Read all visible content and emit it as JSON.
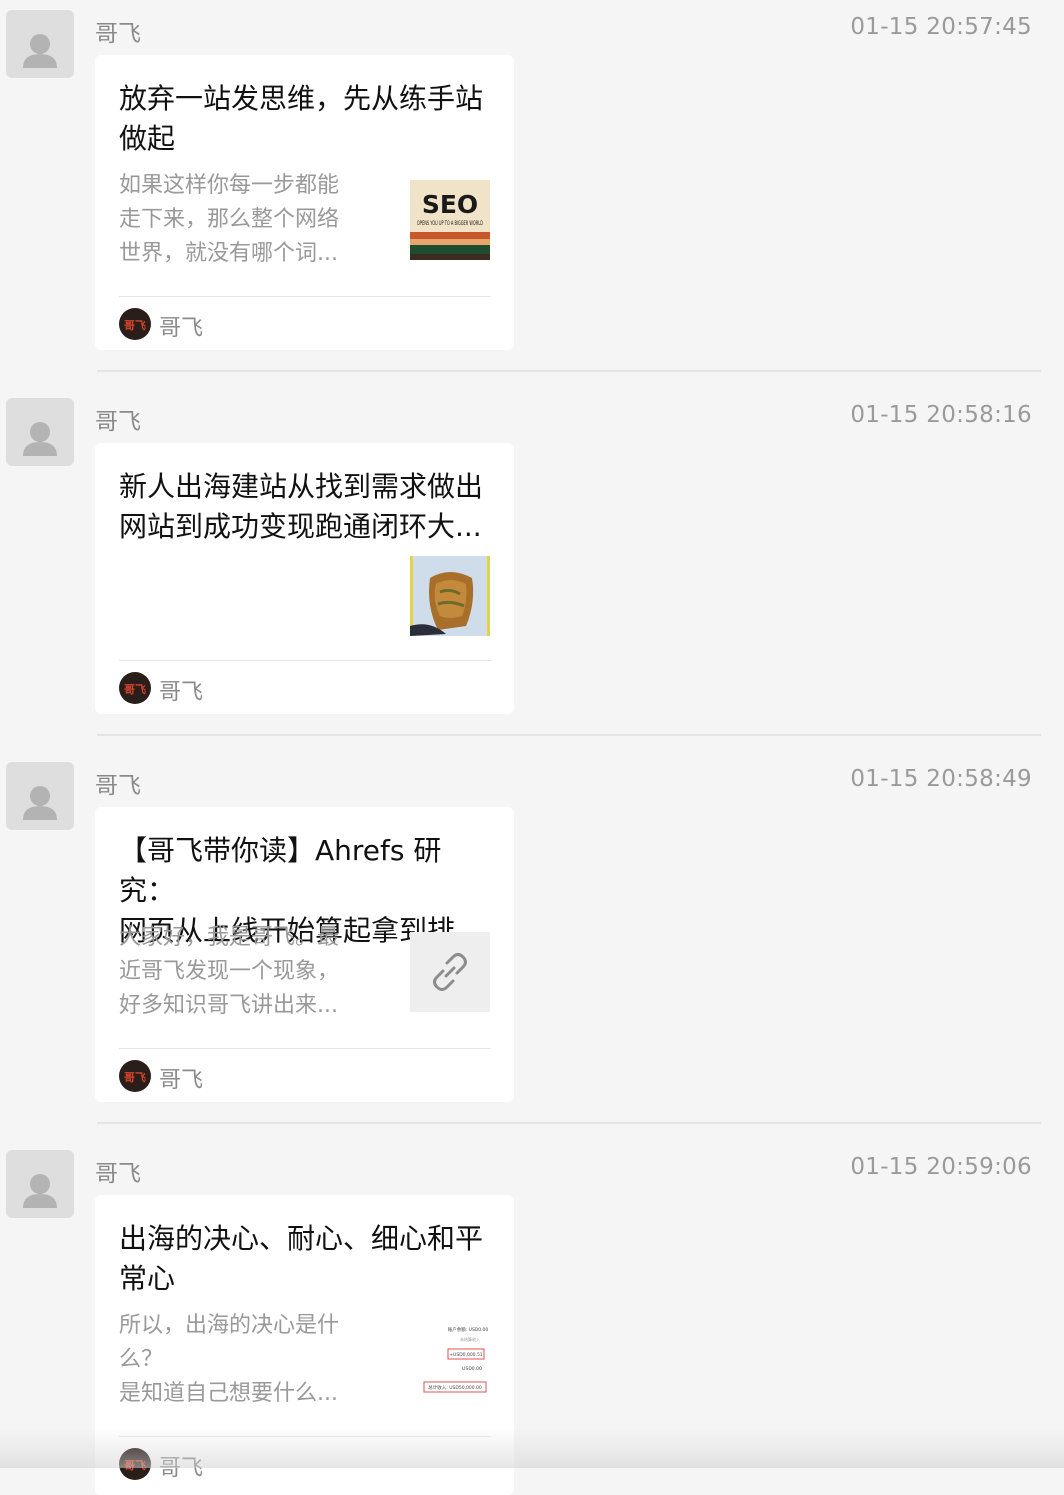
{
  "messages": [
    {
      "sender": "哥飞",
      "time": "01-15 20:57:45",
      "title": "放弃一站发思维，先从练手站\n做起",
      "desc": "如果这样你每一步都能\n走下来，那么整个网络\n世界，就没有哪个词...",
      "thumb_icon": "seo-cover-image",
      "thumb_text_main": "SEO",
      "thumb_text_sub": "OPENS YOU UP TO A BIGGER WORLD",
      "account_name": "哥飞",
      "account_icon_text": "哥飞"
    },
    {
      "sender": "哥飞",
      "time": "01-15 20:58:16",
      "title": "新人出海建站从找到需求做出\n网站到成功变现跑通闭环大...",
      "desc": "",
      "thumb_icon": "food-photo-image",
      "account_name": "哥飞",
      "account_icon_text": "哥飞"
    },
    {
      "sender": "哥飞",
      "time": "01-15 20:58:49",
      "title": "【哥飞带你读】Ahrefs 研究：\n网页从上线开始算起拿到排...",
      "desc": "大家好，我是哥飞。最\n近哥飞发现一个现象，\n好多知识哥飞讲出来...",
      "thumb_icon": "link-icon",
      "account_name": "哥飞",
      "account_icon_text": "哥飞"
    },
    {
      "sender": "哥飞",
      "time": "01-15 20:59:06",
      "title": "出海的决心、耐心、细心和平\n常心",
      "desc": "所以，出海的决心是什\n么？\n是知道自己想要什么...",
      "thumb_icon": "payment-screenshot-image",
      "thumb_lines": [
        "账户余额: USD0.00",
        "未结算收入",
        "+USD0,000.51",
        "USD0.00",
        "总计收入: USD50,000.00"
      ],
      "account_name": "哥飞",
      "account_icon_text": "哥飞"
    }
  ],
  "colors": {
    "background": "#f5f5f5",
    "card": "#ffffff",
    "meta_text": "#8a8a8a",
    "desc_text": "#999999",
    "title_text": "#111111"
  }
}
